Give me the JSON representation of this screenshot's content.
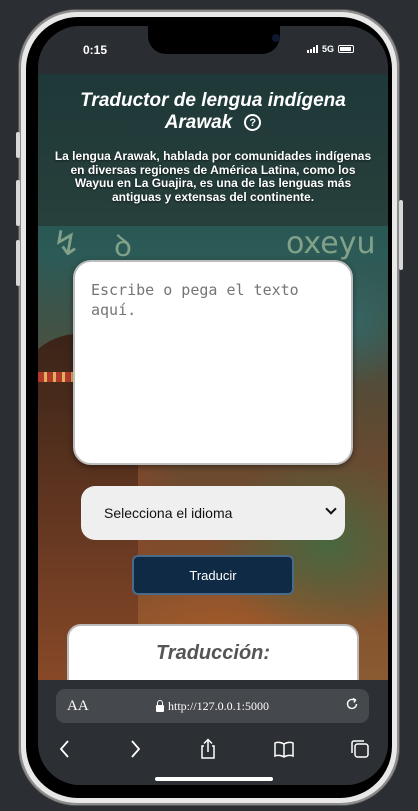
{
  "status_bar": {
    "time": "0:15",
    "network": "5G"
  },
  "app": {
    "title": "Traductor de lengua indígena Arawak",
    "help_symbol": "?",
    "description": "La lengua Arawak, hablada por comunidades indígenas en diversas regiones de América Latina, como los Wayuu en La Guajira, es una de las lenguas más antiguas y extensas del continente.",
    "background_text": "oxeyu"
  },
  "form": {
    "input_placeholder": "Escribe o pega el texto aquí.",
    "language_select_value": "Selecciona el idioma",
    "translate_label": "Traducir"
  },
  "result": {
    "title": "Traducción:"
  },
  "browser": {
    "text_size_label": "AA",
    "url": "http://127.0.0.1:5000"
  },
  "colors": {
    "button_bg": "#0f2a44",
    "header_overlay": "#1e3737",
    "browser_bar": "#2c2f33"
  }
}
